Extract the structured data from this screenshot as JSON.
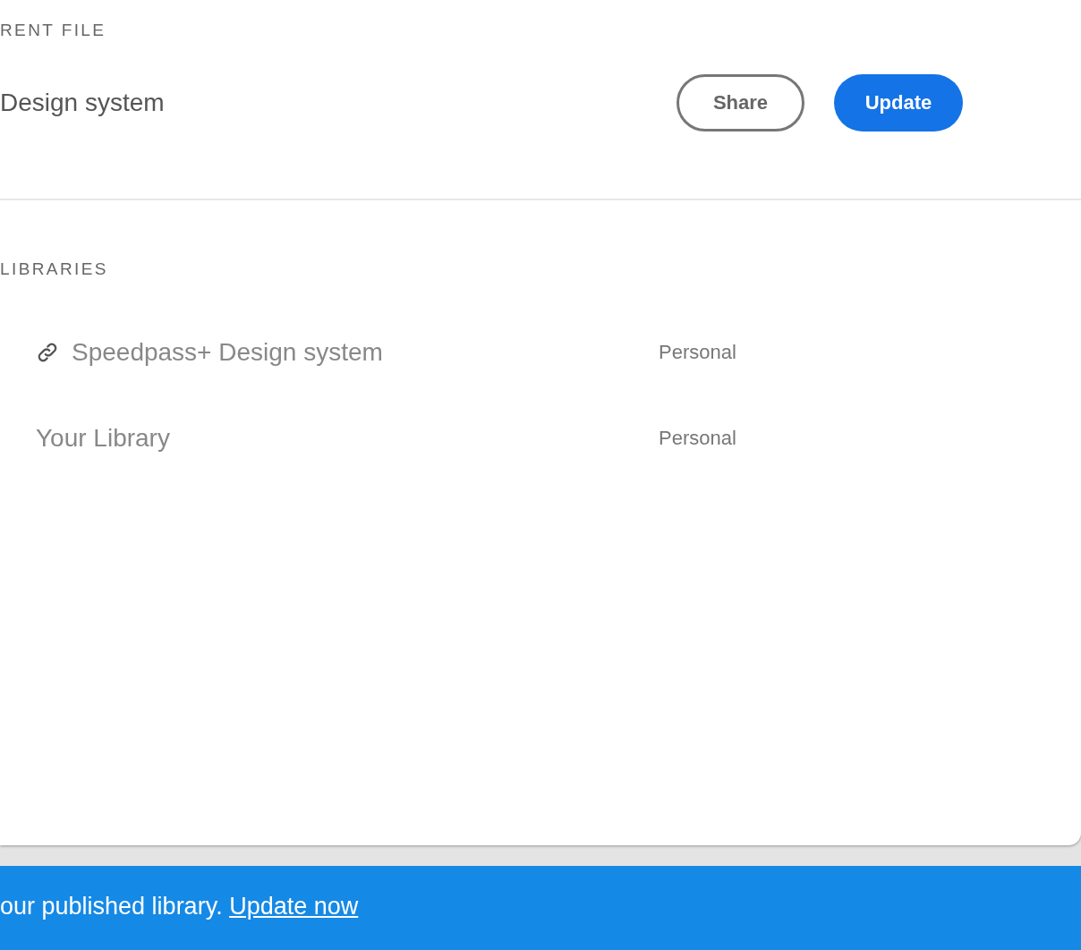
{
  "current_file": {
    "heading": "RENT FILE",
    "name": "Design system",
    "buttons": [
      {
        "label": "Share",
        "kind": "secondary"
      },
      {
        "label": "Update",
        "kind": "primary"
      }
    ]
  },
  "libraries": {
    "heading": "LIBRARIES",
    "items": [
      {
        "name": "Speedpass+ Design system",
        "owner": "Personal",
        "linked": true
      },
      {
        "name": "Your Library",
        "owner": "Personal",
        "linked": false
      }
    ]
  },
  "banner": {
    "text": "our published library.",
    "link": "Update now"
  }
}
